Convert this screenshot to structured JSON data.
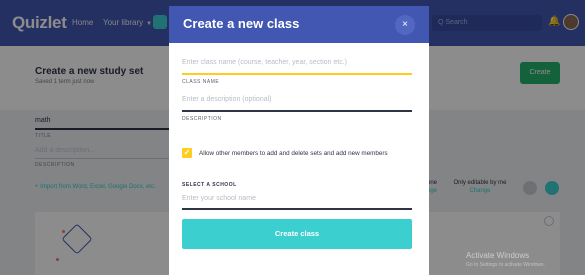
{
  "nav": {
    "logo": "Quizlet",
    "home": "Home",
    "library": "Your library",
    "search_placeholder": "Q Search"
  },
  "page": {
    "title": "Create a new study set",
    "subtitle": "Saved 1 term just now",
    "create_button": "Create",
    "title_value": "math",
    "title_label": "TITLE",
    "description_placeholder": "Add a description...",
    "description_label": "DESCRIPTION",
    "import_link": "+ Import from Word, Excel, Google Docs, etc.",
    "visible_label": "one",
    "visible_change": "nge",
    "editable_label": "Only editable by me",
    "editable_change": "Change"
  },
  "modal": {
    "title": "Create a new class",
    "close_icon": "×",
    "class_name_placeholder": "Enter class name (course, teacher, year, section etc.)",
    "class_name_label": "CLASS NAME",
    "description_placeholder": "Enter a description (optional)",
    "description_label": "DESCRIPTION",
    "checkbox_checked": true,
    "checkbox_label": "Allow other members to add and delete sets and add new members",
    "school_label": "SELECT A SCHOOL",
    "school_placeholder": "Enter your school name",
    "create_button": "Create class"
  },
  "watermark": {
    "title": "Activate Windows",
    "subtitle": "Go to Settings to activate Windows."
  },
  "colors": {
    "brand": "#4257b2",
    "accent": "#3ccfcf",
    "highlight": "#ffcd1f",
    "success": "#23b26d"
  }
}
